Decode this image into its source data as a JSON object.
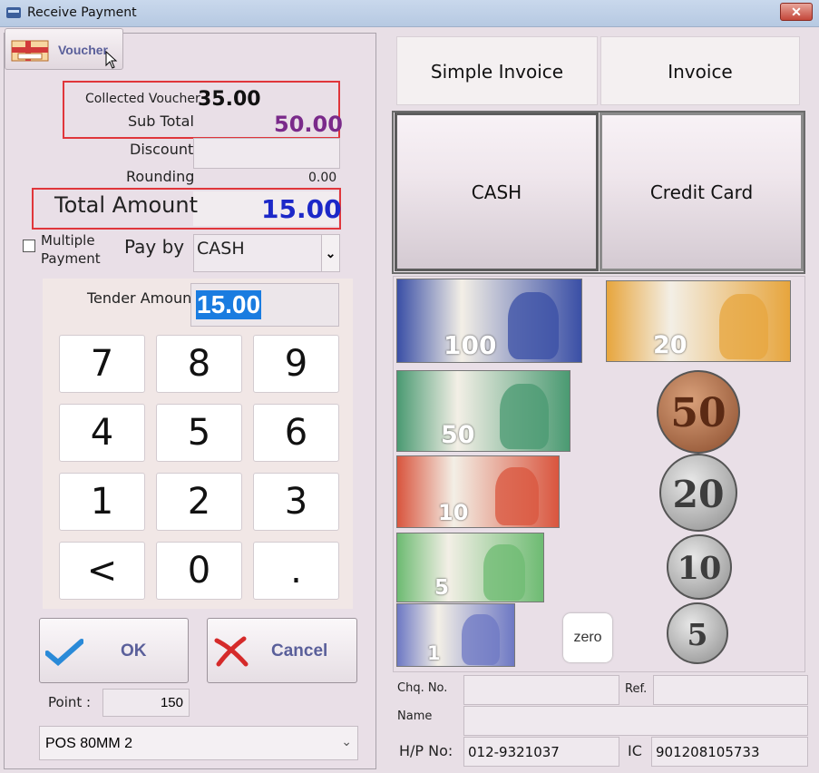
{
  "window": {
    "title": "Receive Payment",
    "close_glyph": "✕"
  },
  "voucher_tab": {
    "label": "Voucher",
    "icon": "voucher-icon"
  },
  "summary": {
    "collected_voucher_label": "Collected Voucher",
    "collected_voucher_value": "35.00",
    "sub_total_label": "Sub Total",
    "sub_total_value": "50.00",
    "discount_label": "Discount",
    "discount_value": "",
    "rounding_label": "Rounding",
    "rounding_value": "0.00",
    "total_label": "Total Amount",
    "total_value": "15.00"
  },
  "payment": {
    "multiple_label_line1": "Multiple",
    "multiple_label_line2": "Payment",
    "pay_by_label": "Pay by",
    "pay_by_value": "CASH",
    "tender_label": "Tender Amount",
    "tender_value": "15.00"
  },
  "numpad": [
    "7",
    "8",
    "9",
    "4",
    "5",
    "6",
    "1",
    "2",
    "3",
    "<",
    "0",
    "."
  ],
  "actions": {
    "ok": "OK",
    "cancel": "Cancel"
  },
  "point": {
    "label": "Point :",
    "value": "150"
  },
  "printer": {
    "value": "POS 80MM 2"
  },
  "invoice_buttons": {
    "simple": "Simple Invoice",
    "invoice": "Invoice"
  },
  "pay_methods": {
    "cash": "CASH",
    "credit": "Credit Card"
  },
  "notes": [
    {
      "value": "100",
      "color": "#3a4fa6"
    },
    {
      "value": "20",
      "color": "#e7a53d"
    },
    {
      "value": "50",
      "color": "#4a9a72"
    },
    {
      "value": "10",
      "color": "#d9553e"
    },
    {
      "value": "5",
      "color": "#6dbb72"
    },
    {
      "value": "1",
      "color": "#6d78c4"
    }
  ],
  "coins": [
    {
      "value": "50"
    },
    {
      "value": "20"
    },
    {
      "value": "10"
    },
    {
      "value": "5"
    }
  ],
  "zero_label": "zero",
  "details": {
    "chq_label": "Chq. No.",
    "chq_value": "",
    "ref_label": "Ref.",
    "ref_value": "",
    "name_label": "Name",
    "name_value": "",
    "hp_label": "H/P No:",
    "hp_value": "012-9321037",
    "ic_label": "IC",
    "ic_value": "901208105733"
  }
}
